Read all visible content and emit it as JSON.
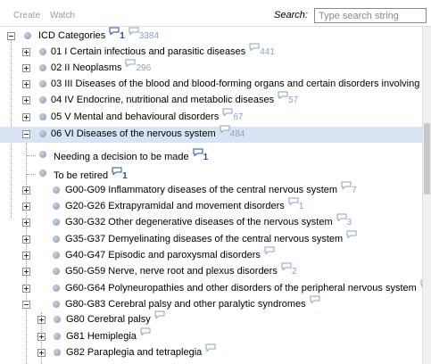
{
  "toolbar": {
    "create_label": "Create",
    "watch_label": "Watch",
    "search_label": "Search:",
    "search_placeholder": "Type search string"
  },
  "tree": [
    {
      "label": "ICD Categories",
      "expander": "minus",
      "comment": "1",
      "comment_style": "bold",
      "count": "3384",
      "level": 0
    },
    {
      "label": "01 I Certain infectious and parasitic diseases",
      "expander": "plus",
      "count": "441",
      "level": 1
    },
    {
      "label": "02 II Neoplasms",
      "expander": "plus",
      "count": "296",
      "level": 1
    },
    {
      "label": "03 III Diseases of the blood and blood-forming organs and certain disorders involving the immune mechanism",
      "expander": "plus",
      "count": "",
      "level": 1
    },
    {
      "label": "04 IV Endocrine, nutritional and metabolic diseases",
      "expander": "plus",
      "count": "57",
      "level": 1
    },
    {
      "label": "05 V Mental and behavioural disorders",
      "expander": "plus",
      "count": "67",
      "level": 1
    },
    {
      "label": "06 VI Diseases of the nervous system",
      "expander": "minus",
      "count": "484",
      "level": 1,
      "selected": true
    },
    {
      "label": "Needing a decision to be made",
      "expander": "none",
      "comment": "1",
      "comment_style": "bold",
      "level": 2
    },
    {
      "label": "To be retired",
      "expander": "none",
      "comment": "1",
      "comment_style": "bold",
      "level": 2
    },
    {
      "label": "G00-G09 Inflammatory diseases of the central nervous system",
      "expander": "plus",
      "count": "7",
      "level": 2
    },
    {
      "label": "G20-G26 Extrapyramidal and movement disorders",
      "expander": "plus",
      "count": "1",
      "level": 2
    },
    {
      "label": "G30-G32 Other degenerative diseases of the nervous system",
      "expander": "plus",
      "count": "3",
      "level": 2
    },
    {
      "label": "G35-G37 Demyelinating diseases of the central nervous system",
      "expander": "plus",
      "count": "",
      "level": 2
    },
    {
      "label": "G40-G47 Episodic and paroxysmal disorders",
      "expander": "plus",
      "count": "",
      "level": 2
    },
    {
      "label": "G50-G59 Nerve, nerve root and plexus disorders",
      "expander": "plus",
      "count": "2",
      "level": 2
    },
    {
      "label": "G60-G64 Polyneuropathies and other disorders of the peripheral nervous system",
      "expander": "plus",
      "count": "1",
      "level": 2
    },
    {
      "label": "G80-G83 Cerebral palsy and other paralytic syndromes",
      "expander": "minus",
      "count": "",
      "level": 2
    },
    {
      "label": "G80 Cerebral palsy",
      "expander": "plus",
      "count": "",
      "level": 3
    },
    {
      "label": "G81 Hemiplegia",
      "expander": "plus",
      "count": "",
      "level": 3
    },
    {
      "label": "G82 Paraplegia and tetraplegia",
      "expander": "plus",
      "count": "",
      "level": 3
    }
  ],
  "colors": {
    "selection": "#d8e4f3",
    "node_dot": "#7f9ab8",
    "comment_bold": "#1f4fa8",
    "comment_count": "#8aa3c4"
  },
  "icons": {
    "expand": "plus-box-icon",
    "collapse": "minus-box-icon",
    "node": "node-dot-icon",
    "comment": "speech-bubble-icon"
  }
}
